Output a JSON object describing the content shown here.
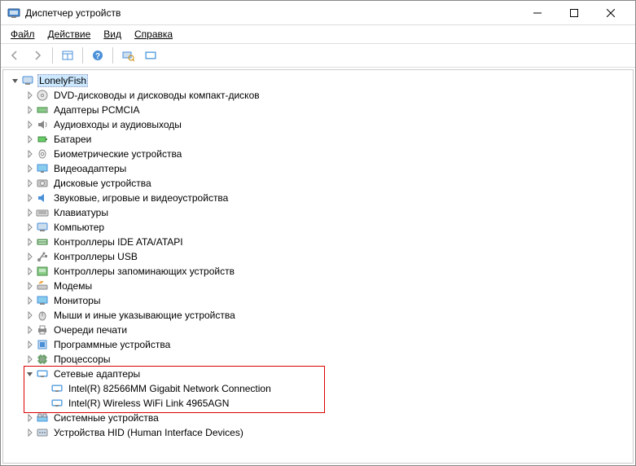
{
  "window": {
    "title": "Диспетчер устройств"
  },
  "menu": {
    "file": "Файл",
    "action": "Действие",
    "view": "Вид",
    "help": "Справка"
  },
  "tree": {
    "root": "LonelyFish",
    "items": [
      {
        "label": "DVD-дисководы и дисководы компакт-дисков",
        "icon": "dvd"
      },
      {
        "label": "Адаптеры PCMCIA",
        "icon": "pcmcia"
      },
      {
        "label": "Аудиовходы и аудиовыходы",
        "icon": "audio"
      },
      {
        "label": "Батареи",
        "icon": "battery"
      },
      {
        "label": "Биометрические устройства",
        "icon": "biometric"
      },
      {
        "label": "Видеоадаптеры",
        "icon": "display"
      },
      {
        "label": "Дисковые устройства",
        "icon": "disk"
      },
      {
        "label": "Звуковые, игровые и видеоустройства",
        "icon": "sound"
      },
      {
        "label": "Клавиатуры",
        "icon": "keyboard"
      },
      {
        "label": "Компьютер",
        "icon": "computer"
      },
      {
        "label": "Контроллеры IDE ATA/ATAPI",
        "icon": "ide"
      },
      {
        "label": "Контроллеры USB",
        "icon": "usb"
      },
      {
        "label": "Контроллеры запоминающих устройств",
        "icon": "storage"
      },
      {
        "label": "Модемы",
        "icon": "modem"
      },
      {
        "label": "Мониторы",
        "icon": "monitor"
      },
      {
        "label": "Мыши и иные указывающие устройства",
        "icon": "mouse"
      },
      {
        "label": "Очереди печати",
        "icon": "printer"
      },
      {
        "label": "Программные устройства",
        "icon": "software"
      },
      {
        "label": "Процессоры",
        "icon": "cpu"
      },
      {
        "label": "Сетевые адаптеры",
        "icon": "network",
        "expanded": true,
        "children": [
          {
            "label": "Intel(R) 82566MM Gigabit Network Connection",
            "icon": "network"
          },
          {
            "label": "Intel(R) Wireless WiFi Link 4965AGN",
            "icon": "network"
          }
        ]
      },
      {
        "label": "Системные устройства",
        "icon": "system"
      },
      {
        "label": "Устройства HID (Human Interface Devices)",
        "icon": "hid"
      }
    ]
  }
}
